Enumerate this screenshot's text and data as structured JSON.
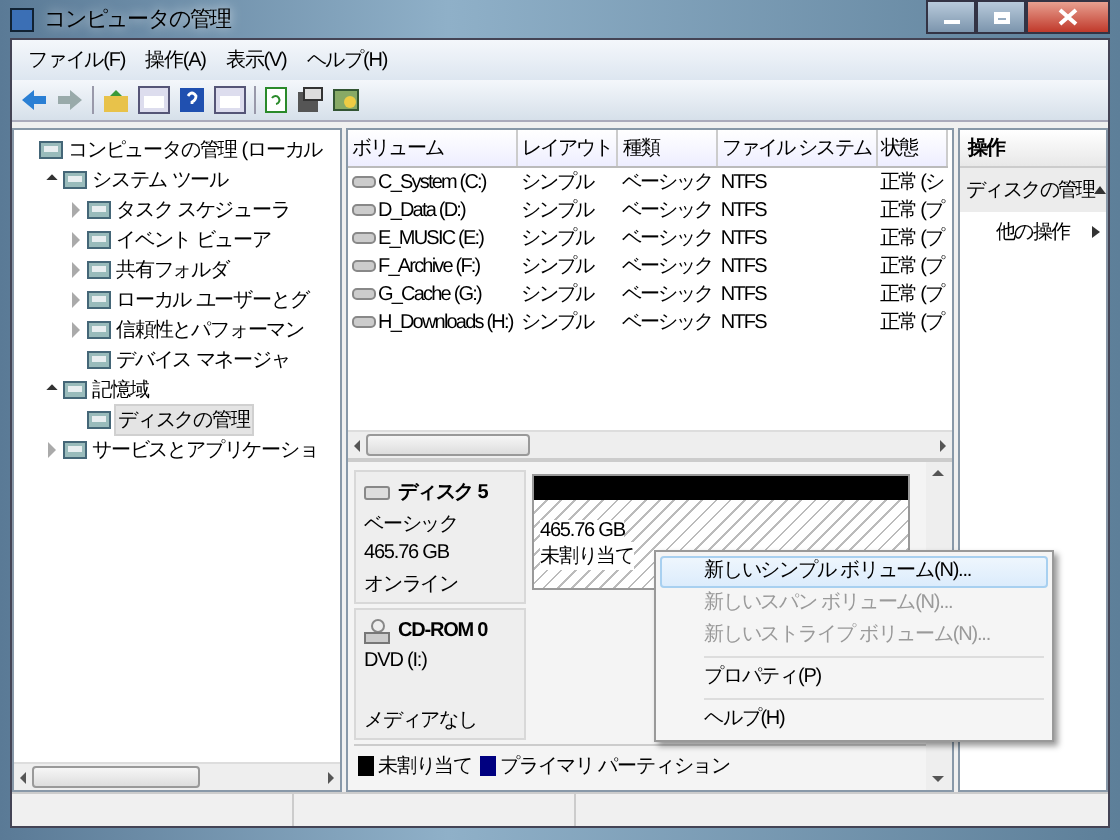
{
  "window": {
    "title": "コンピュータの管理"
  },
  "menu": [
    "ファイル(F)",
    "操作(A)",
    "表示(V)",
    "ヘルプ(H)"
  ],
  "tree": [
    {
      "label": "コンピュータの管理 (ローカル",
      "selected": false,
      "children": [
        {
          "label": "システム ツール",
          "selected": false,
          "expanded": true,
          "children": [
            {
              "label": "タスク スケジューラ",
              "selected": false,
              "expanded": false
            },
            {
              "label": "イベント ビューア",
              "selected": false,
              "expanded": false
            },
            {
              "label": "共有フォルダ",
              "selected": false,
              "expanded": false
            },
            {
              "label": "ローカル ユーザーとグ",
              "selected": false,
              "expanded": false
            },
            {
              "label": "信頼性とパフォーマン",
              "selected": false,
              "expanded": false
            },
            {
              "label": "デバイス マネージャ",
              "selected": false
            }
          ]
        },
        {
          "label": "記憶域",
          "selected": false,
          "expanded": true,
          "children": [
            {
              "label": "ディスクの管理",
              "selected": true
            }
          ]
        },
        {
          "label": "サービスとアプリケーショ",
          "selected": false,
          "expanded": false
        }
      ]
    }
  ],
  "table": {
    "columns": [
      "ボリューム",
      "レイアウト",
      "種類",
      "ファイル システム",
      "状態"
    ],
    "rows": [
      [
        "C_System (C:)",
        "シンプル",
        "ベーシック",
        "NTFS",
        "正常 (シ"
      ],
      [
        "D_Data (D:)",
        "シンプル",
        "ベーシック",
        "NTFS",
        "正常 (プ"
      ],
      [
        "E_MUSIC (E:)",
        "シンプル",
        "ベーシック",
        "NTFS",
        "正常 (プ"
      ],
      [
        "F_Archive (F:)",
        "シンプル",
        "ベーシック",
        "NTFS",
        "正常 (プ"
      ],
      [
        "G_Cache (G:)",
        "シンプル",
        "ベーシック",
        "NTFS",
        "正常 (プ"
      ],
      [
        "H_Downloads (H:)",
        "シンプル",
        "ベーシック",
        "NTFS",
        "正常 (プ"
      ]
    ]
  },
  "disks": [
    {
      "kind": "disk",
      "name": "ディスク 5",
      "lines": [
        "ベーシック",
        "465.76 GB",
        "オンライン"
      ],
      "partition": {
        "size": "465.76 GB",
        "status": "未割り当て"
      }
    },
    {
      "kind": "cdrom",
      "name": "CD-ROM 0",
      "lines": [
        "DVD (I:)",
        "メディアなし"
      ]
    }
  ],
  "legend": [
    {
      "label": "未割り当て",
      "color": "#000000"
    },
    {
      "label": "プライマリ パーティション",
      "color": "#000080"
    }
  ],
  "actions": {
    "title": "操作",
    "section": "ディスクの管理",
    "expanded": true,
    "items": [
      "他の操作"
    ]
  },
  "context_menu": [
    {
      "label": "新しいシンプル ボリューム(N)...",
      "disabled": false,
      "selected": true,
      "separator_before": false
    },
    {
      "label": "新しいスパン ボリューム(N)...",
      "disabled": true,
      "selected": false,
      "separator_before": false
    },
    {
      "label": "新しいストライプ ボリューム(N)...",
      "disabled": true,
      "selected": false,
      "separator_before": false
    },
    {
      "label": "プロパティ(P)",
      "disabled": false,
      "selected": false,
      "separator_before": true
    },
    {
      "label": "ヘルプ(H)",
      "disabled": false,
      "selected": false,
      "separator_before": true
    }
  ]
}
